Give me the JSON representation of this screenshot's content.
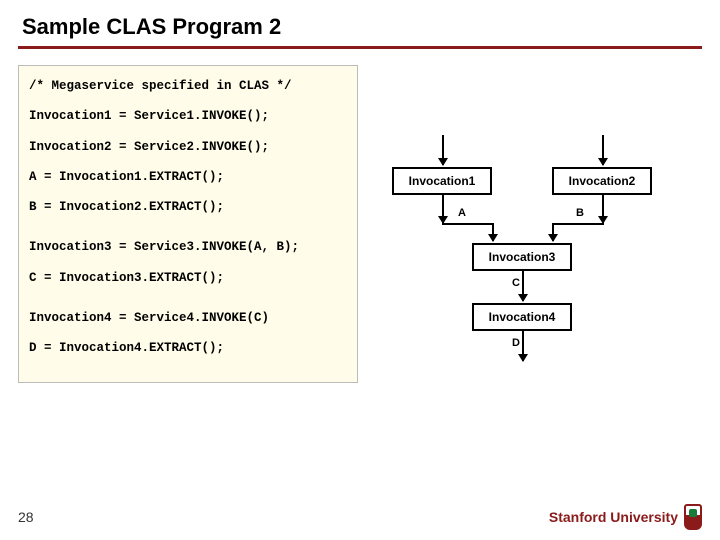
{
  "title": "Sample CLAS Program 2",
  "code": {
    "l0": "/* Megaservice specified in CLAS */",
    "l1": "Invocation1 = Service1.INVOKE();",
    "l2": "Invocation2 = Service2.INVOKE();",
    "l3": "A = Invocation1.EXTRACT();",
    "l4": "B = Invocation2.EXTRACT();",
    "l5": "Invocation3 = Service3.INVOKE(A, B);",
    "l6": "C = Invocation3.EXTRACT();",
    "l7": "Invocation4 = Service4.INVOKE(C)",
    "l8": "D = Invocation4.EXTRACT();"
  },
  "diagram": {
    "nodes": {
      "n1": "Invocation1",
      "n2": "Invocation2",
      "n3": "Invocation3",
      "n4": "Invocation4"
    },
    "edge_labels": {
      "a": "A",
      "b": "B",
      "c": "C",
      "d": "D"
    }
  },
  "footer": {
    "page": "28",
    "org": "Stanford University"
  }
}
